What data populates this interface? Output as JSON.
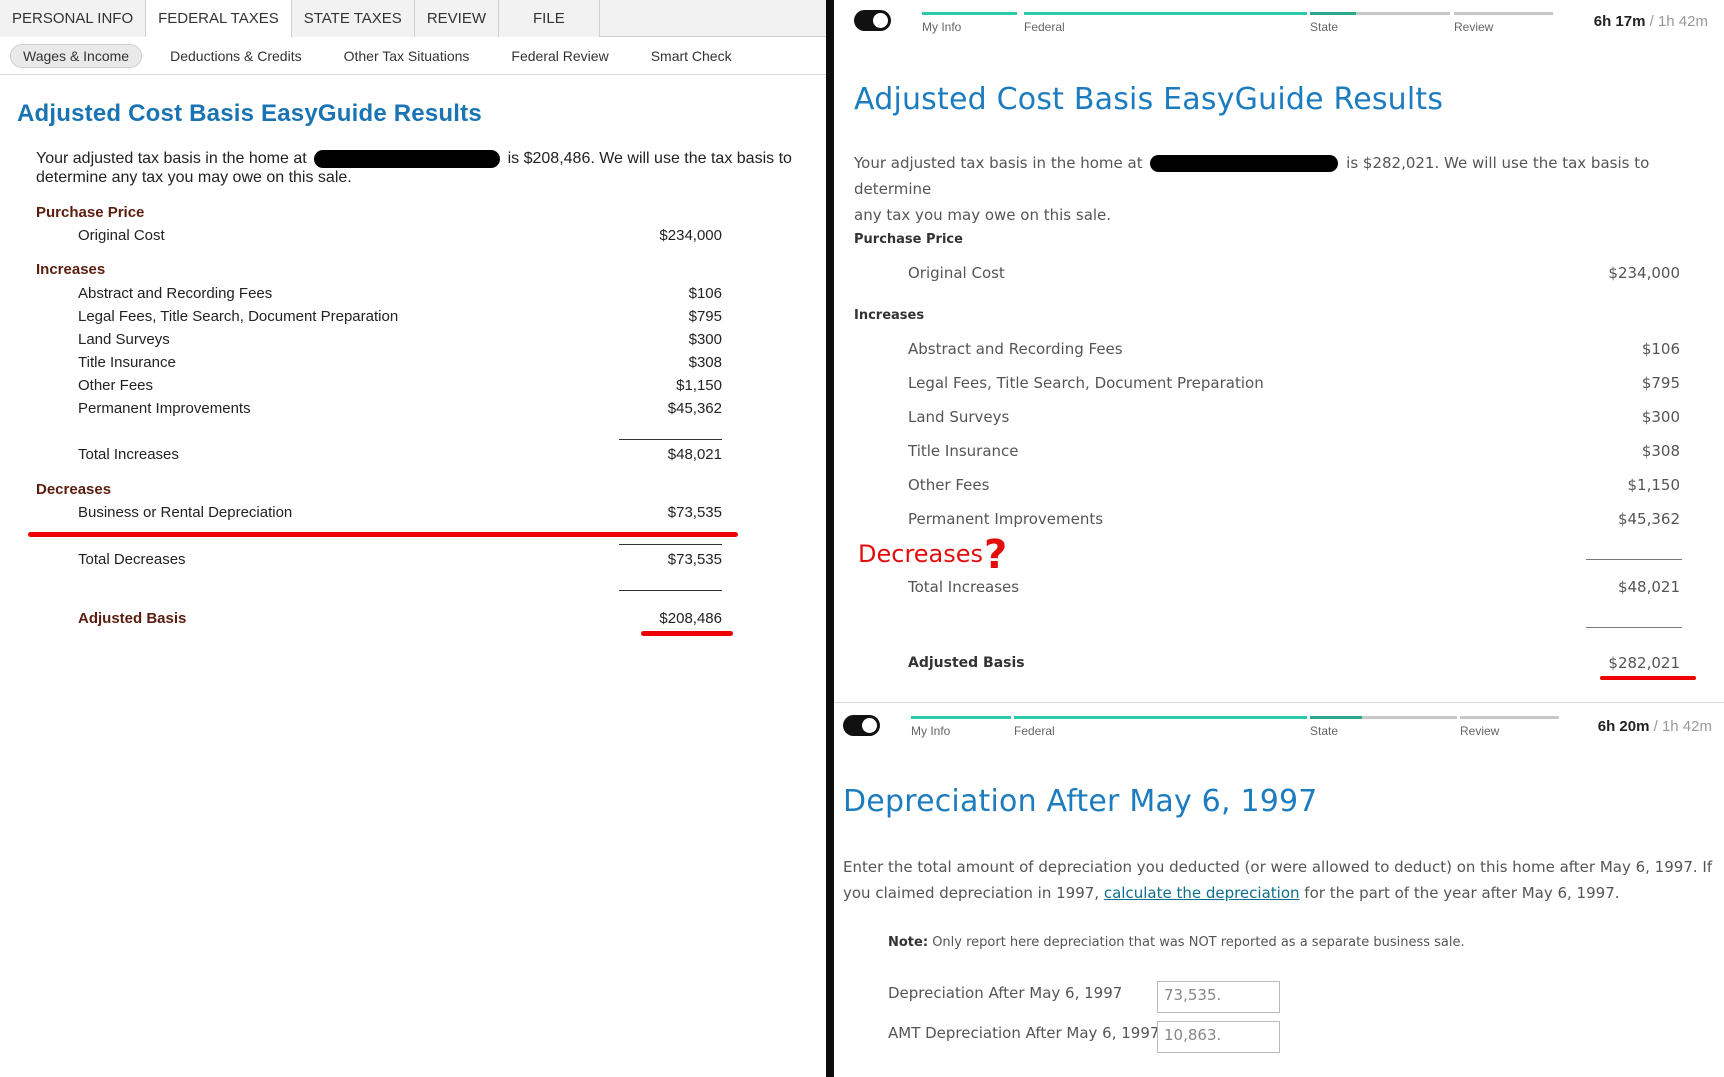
{
  "left": {
    "tabs": [
      "PERSONAL INFO",
      "FEDERAL TAXES",
      "STATE TAXES",
      "REVIEW",
      "FILE"
    ],
    "subnav": [
      "Wages & Income",
      "Deductions & Credits",
      "Other Tax Situations",
      "Federal Review",
      "Smart Check"
    ],
    "title": "Adjusted Cost Basis EasyGuide Results",
    "intro_before": "Your adjusted tax basis in the home at",
    "intro_after": "is $208,486. We will use the tax basis to",
    "intro_line2": "determine any tax you may owe on this sale.",
    "purchase_price": "Purchase Price",
    "original_cost_label": "Original Cost",
    "original_cost": "$234,000",
    "increases": "Increases",
    "increase_items": [
      {
        "label": "Abstract and Recording Fees",
        "value": "$106"
      },
      {
        "label": "Legal Fees, Title Search, Document Preparation",
        "value": "$795"
      },
      {
        "label": "Land Surveys",
        "value": "$300"
      },
      {
        "label": "Title Insurance",
        "value": "$308"
      },
      {
        "label": "Other Fees",
        "value": "$1,150"
      },
      {
        "label": "Permanent Improvements",
        "value": "$45,362"
      }
    ],
    "total_increases_label": "Total Increases",
    "total_increases": "$48,021",
    "decreases": "Decreases",
    "depreciation_label": "Business or Rental Depreciation",
    "depreciation": "$73,535",
    "total_decreases_label": "Total Decreases",
    "total_decreases": "$73,535",
    "adjusted_basis_label": "Adjusted Basis",
    "adjusted_basis": "$208,486"
  },
  "right_top": {
    "progress_labels": [
      "My Info",
      "Federal",
      "State",
      "Review"
    ],
    "timer_elapsed": "6h 17m",
    "timer_total": "/ 1h 42m",
    "title": "Adjusted Cost Basis EasyGuide Results",
    "intro_before": "Your adjusted tax basis in the home at",
    "intro_after": "is $282,021. We will use the tax basis to determine",
    "intro_line2": "any tax you may owe on this sale.",
    "purchase_price": "Purchase Price",
    "original_cost_label": "Original Cost",
    "original_cost": "$234,000",
    "increases": "Increases",
    "increase_items": [
      {
        "label": "Abstract and Recording Fees",
        "value": "$106"
      },
      {
        "label": "Legal Fees, Title Search, Document Preparation",
        "value": "$795"
      },
      {
        "label": "Land Surveys",
        "value": "$300"
      },
      {
        "label": "Title Insurance",
        "value": "$308"
      },
      {
        "label": "Other Fees",
        "value": "$1,150"
      },
      {
        "label": "Permanent Improvements",
        "value": "$45,362"
      }
    ],
    "annotation": "Decreases",
    "annotation_mark": "?",
    "total_increases_label": "Total Increases",
    "total_increases": "$48,021",
    "adjusted_basis_label": "Adjusted Basis",
    "adjusted_basis": "$282,021"
  },
  "right_bottom": {
    "progress_labels": [
      "My Info",
      "Federal",
      "State",
      "Review"
    ],
    "timer_elapsed": "6h 20m",
    "timer_total": "/ 1h 42m",
    "title": "Depreciation After May 6, 1997",
    "text_line1": "Enter the total amount of depreciation you deducted (or were allowed to deduct) on this home after May 6, 1997. If",
    "text_line2_before": "you claimed depreciation in 1997,",
    "text_link": "calculate the depreciation",
    "text_line2_after": "for the part of the year after May 6, 1997.",
    "note_label": "Note:",
    "note_text": "Only report here depreciation that was NOT reported as a separate business sale.",
    "field1_label": "Depreciation After May 6, 1997",
    "field1_value": "73,535.",
    "field2_label": "AMT Depreciation After May 6, 1997",
    "field2_value": "10,863."
  },
  "colors": {
    "left_title": "#1a74b3",
    "right_title": "#1c7cbf",
    "section_brown": "#5a1e0f",
    "annotation_red": "#e30d0d",
    "progress_teal": "#2cc9a6",
    "progress_gray": "#c8c8c8"
  }
}
